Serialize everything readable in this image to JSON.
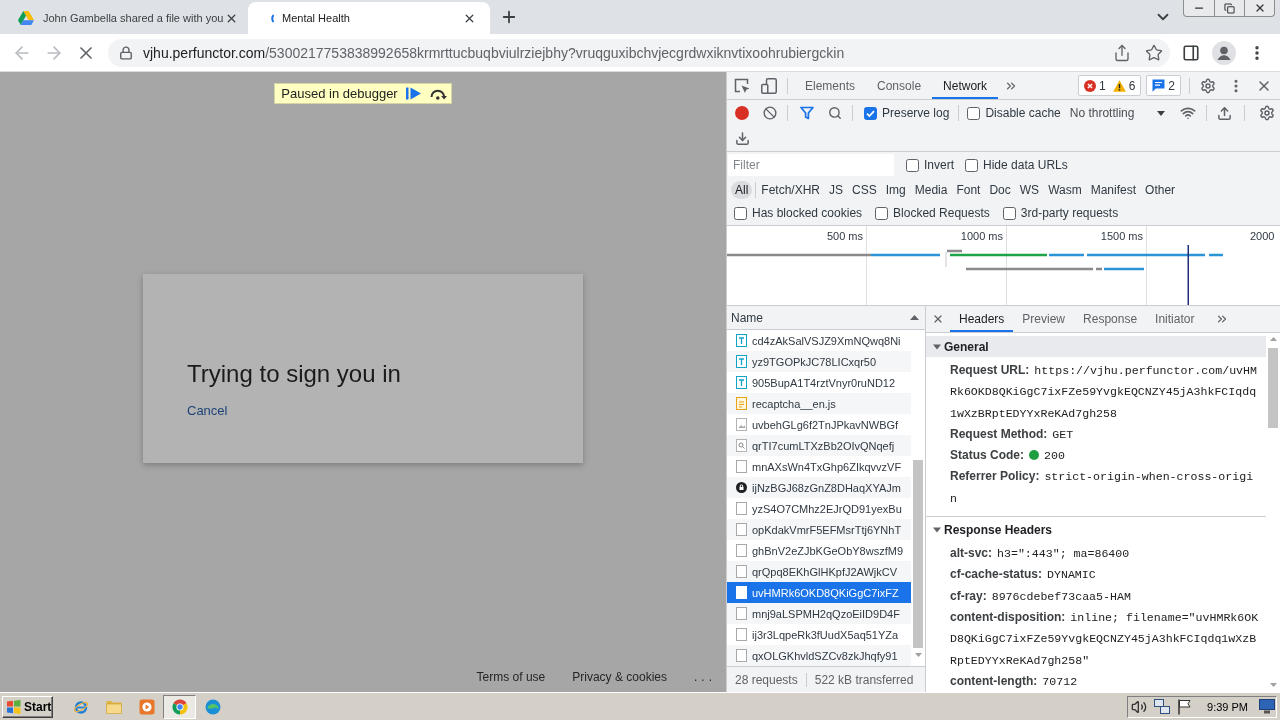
{
  "browser": {
    "tabs": [
      {
        "title": "John Gambella shared a file with you",
        "kind": "drive",
        "selected": false
      },
      {
        "title": "Mental Health",
        "kind": "loading",
        "selected": true
      }
    ],
    "nav": [
      {
        "kind": "back",
        "disabled": true
      },
      {
        "kind": "forward",
        "disabled": true
      },
      {
        "kind": "stop",
        "disabled": false
      }
    ],
    "address": {
      "host": "vjhu.perfunctor.com",
      "path": "/5300217753838992658krmrttucbuqbviulrziejbhy?vruqguxibchvjecgrdwxiknvtixoohrubiergckin"
    }
  },
  "page": {
    "debugger_banner": "Paused in debugger",
    "dialog": {
      "title": "Trying to sign you in",
      "link": "Cancel"
    },
    "footer_links": [
      "Terms of use",
      "Privacy & cookies",
      "..."
    ]
  },
  "devtools": {
    "tabs": [
      {
        "label": "Elements",
        "selected": false
      },
      {
        "label": "Console",
        "selected": false
      },
      {
        "label": "Network",
        "selected": true
      }
    ],
    "counters": [
      {
        "items": [
          {
            "kind": "error",
            "count": "1"
          },
          {
            "kind": "warning",
            "count": "6"
          }
        ]
      },
      {
        "items": [
          {
            "kind": "message",
            "count": "2"
          }
        ]
      }
    ],
    "toolbar": {
      "recording": true,
      "filter_active": true,
      "options": [
        {
          "label": "Preserve log",
          "checked": true
        },
        {
          "label": "Disable cache",
          "checked": false
        }
      ],
      "throttling": "No throttling"
    },
    "filter": {
      "placeholder": "Filter",
      "options": [
        {
          "label": "Invert",
          "checked": false
        },
        {
          "label": "Hide data URLs",
          "checked": false
        }
      ]
    },
    "types": [
      {
        "label": "All",
        "selected": true
      },
      {
        "label": "Fetch/XHR",
        "selected": false
      },
      {
        "label": "JS",
        "selected": false
      },
      {
        "label": "CSS",
        "selected": false
      },
      {
        "label": "Img",
        "selected": false
      },
      {
        "label": "Media",
        "selected": false
      },
      {
        "label": "Font",
        "selected": false
      },
      {
        "label": "Doc",
        "selected": false
      },
      {
        "label": "WS",
        "selected": false
      },
      {
        "label": "Wasm",
        "selected": false
      },
      {
        "label": "Manifest",
        "selected": false
      },
      {
        "label": "Other",
        "selected": false
      }
    ],
    "extra_filters": [
      {
        "label": "Has blocked cookies",
        "checked": false
      },
      {
        "label": "Blocked Requests",
        "checked": false
      },
      {
        "label": "3rd-party requests",
        "checked": false
      }
    ],
    "overview": {
      "ticks": [
        "500 ms",
        "1000 ms",
        "1500 ms",
        "2000"
      ]
    },
    "requests": {
      "column": "Name",
      "rows": [
        {
          "name": "cd4zAkSalVSJZ9XmNQwq8Ni",
          "kind": "font",
          "selected": false
        },
        {
          "name": "yz9TGOPkJC78LICxqr50",
          "kind": "font",
          "selected": false
        },
        {
          "name": "905BupA1T4rztVnyr0ruND12",
          "kind": "font",
          "selected": false
        },
        {
          "name": "recaptcha__en.js",
          "kind": "script",
          "selected": false
        },
        {
          "name": "uvbehGLg6f2TnJPkavNWBGf",
          "kind": "image",
          "selected": false
        },
        {
          "name": "qrTI7cumLTXzBb2OIvQNqefj",
          "kind": "fetch",
          "selected": false
        },
        {
          "name": "mnAXsWn4TxGhp6ZIkqvvzVF",
          "kind": "document",
          "selected": false
        },
        {
          "name": "ijNzBGJ68zGnZ8DHaqXYAJm",
          "kind": "secure",
          "selected": false
        },
        {
          "name": "yzS4O7CMhz2EJrQD91yexBu",
          "kind": "document",
          "selected": false
        },
        {
          "name": "opKdakVmrF5EFMsrTtj6YNhT",
          "kind": "document",
          "selected": false
        },
        {
          "name": "ghBnV2eZJbKGeObY8wszfM9",
          "kind": "document",
          "selected": false
        },
        {
          "name": "qrQpq8EKhGlHKpfJ2AWjkCV",
          "kind": "document",
          "selected": false
        },
        {
          "name": "uvHMRk6OKD8QKiGgC7ixFZ",
          "kind": "document",
          "selected": true
        },
        {
          "name": "mnj9aLSPMH2qQzoEiID9D4F",
          "kind": "document",
          "selected": false
        },
        {
          "name": "ij3r3LqpeRk3fUudX5aq51YZa",
          "kind": "document",
          "selected": false
        },
        {
          "name": "qxOLGKhvldSZCv8zkJhqfy91",
          "kind": "document",
          "selected": false
        }
      ]
    },
    "summary": [
      "28 requests",
      "522 kB transferred"
    ],
    "details": {
      "tabs": [
        {
          "label": "Headers",
          "selected": true
        },
        {
          "label": "Preview",
          "selected": false
        },
        {
          "label": "Response",
          "selected": false
        },
        {
          "label": "Initiator",
          "selected": false
        }
      ],
      "sections": [
        {
          "title": "General",
          "expanded": true,
          "selected": true,
          "rows": [
            {
              "name": "Request URL:",
              "value": "https://vjhu.perfunctor.com/uvHMRk6OKD8QKiGgC7ixFZe59YvgkEQCNZY45jA3hkFCIqdq1wXzBRptEDYYxReKAd7gh258"
            },
            {
              "name": "Request Method:",
              "value": "GET"
            },
            {
              "name": "Status Code:",
              "value": "200",
              "color": "#1e9e3e"
            },
            {
              "name": "Referrer Policy:",
              "value": "strict-origin-when-cross-origin"
            }
          ]
        },
        {
          "title": "Response Headers",
          "expanded": true,
          "selected": false,
          "rows": [
            {
              "name": "alt-svc:",
              "value": "h3=\":443\"; ma=86400"
            },
            {
              "name": "cf-cache-status:",
              "value": "DYNAMIC"
            },
            {
              "name": "cf-ray:",
              "value": "8976cdebef73caa5-HAM"
            },
            {
              "name": "content-disposition:",
              "value": "inline; filename=\"uvHMRk6OKD8QKiGgC7ixFZe59YvgkEQCNZY45jA3hkFCIqdq1wXzBRptEDYYxReKAd7gh258\""
            },
            {
              "name": "content-length:",
              "value": "70712"
            }
          ]
        }
      ]
    }
  },
  "taskbar": {
    "start": "Start",
    "apps": [
      {
        "kind": "ie",
        "selected": false
      },
      {
        "kind": "folder",
        "selected": false
      },
      {
        "kind": "media",
        "selected": false
      },
      {
        "kind": "chrome",
        "selected": true
      },
      {
        "kind": "edge",
        "selected": false
      }
    ],
    "clock": "9:39 PM"
  }
}
